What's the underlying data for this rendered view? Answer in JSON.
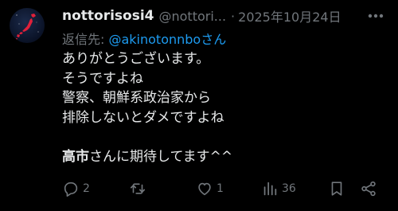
{
  "author": {
    "display_name": "nottorisosi4",
    "handle": "@nottori...",
    "separator": "·",
    "date": "2025年10月24日",
    "avatar_icon": "japan-map-avatar"
  },
  "reply": {
    "prefix": "返信先: ",
    "mention": "@akinotonnboさん"
  },
  "body": {
    "lines": [
      "ありがとうございます。",
      "そうですよね",
      "警察、朝鮮系政治家から",
      "排除しないとダメですよね"
    ],
    "last_line_bold": "高市",
    "last_line_rest": "さんに期待してます^^"
  },
  "actions": {
    "reply_count": "2",
    "retweet_count": "",
    "like_count": "1",
    "views_count": "36"
  },
  "colors": {
    "background": "#000000",
    "text": "#e7e9ea",
    "muted": "#71767b",
    "link": "#1d9bf0"
  }
}
